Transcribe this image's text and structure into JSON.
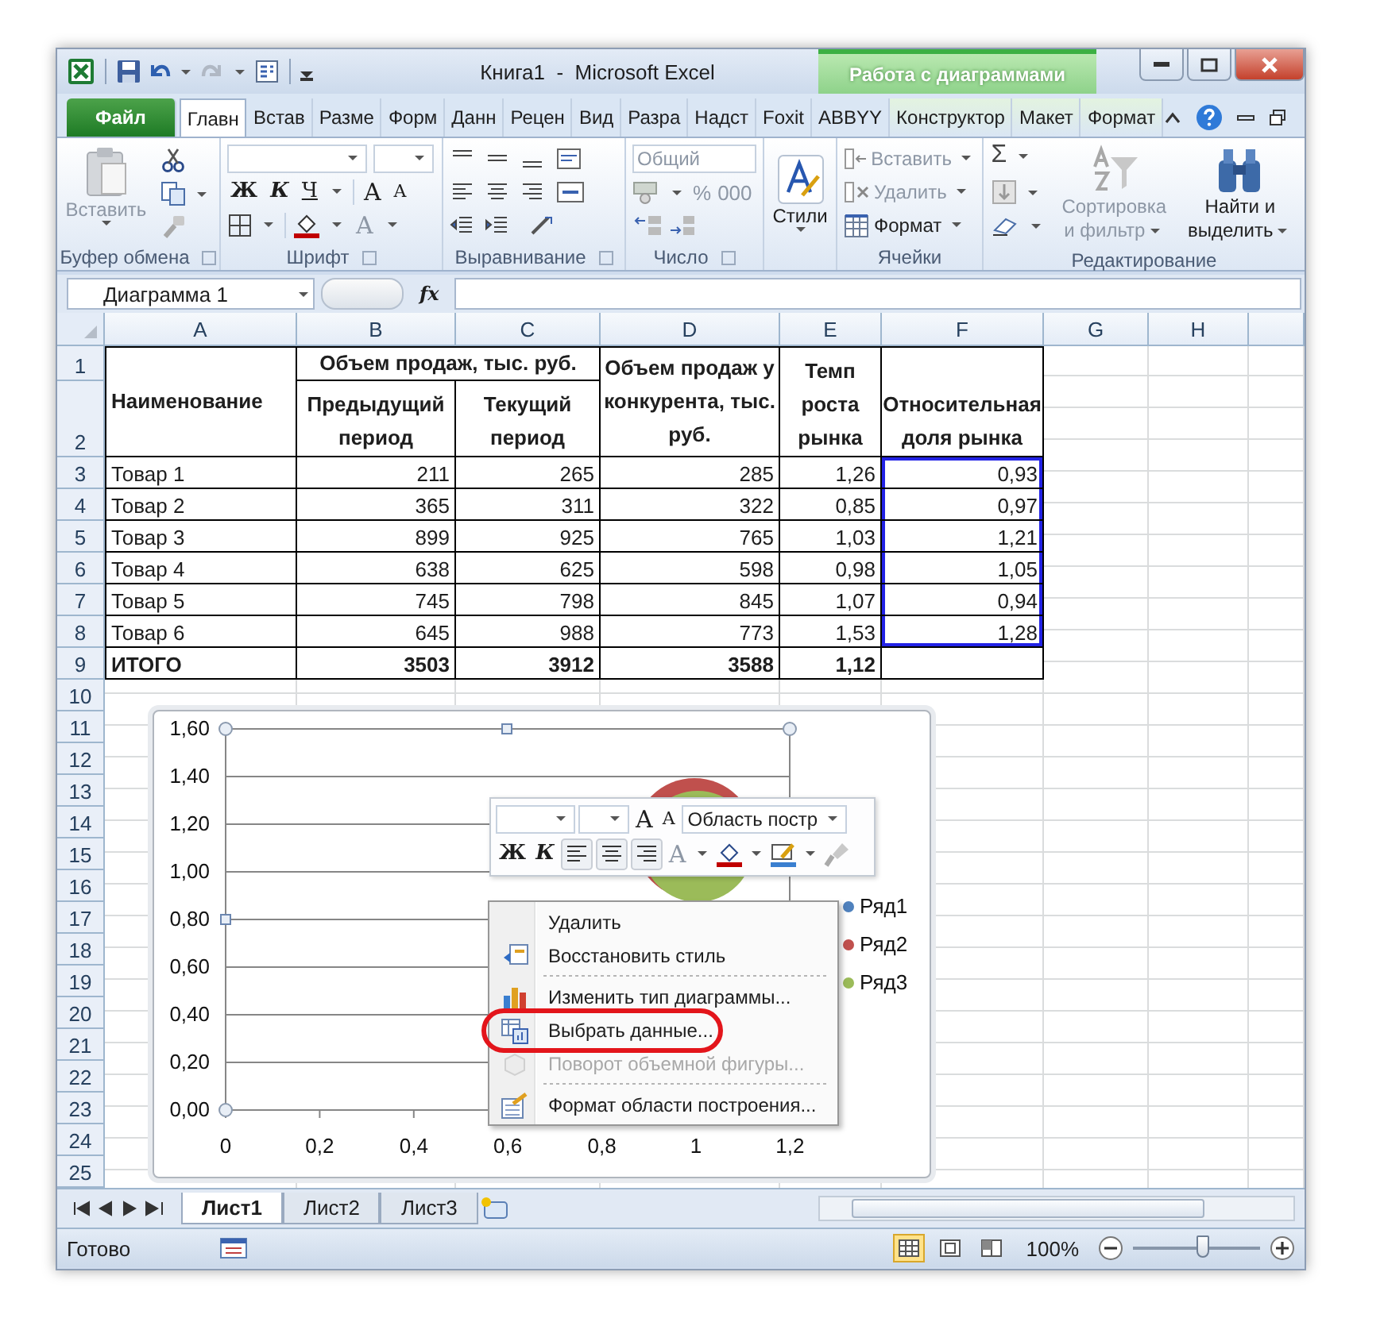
{
  "window": {
    "title": "Книга1  -  Microsoft Excel",
    "context_group": "Работа с диаграммами"
  },
  "tabs": [
    {
      "label": "Файл",
      "kind": "file",
      "selected": false
    },
    {
      "label": "Главн",
      "kind": "normal",
      "selected": true
    },
    {
      "label": "Встав",
      "kind": "normal",
      "selected": false
    },
    {
      "label": "Разме",
      "kind": "normal",
      "selected": false
    },
    {
      "label": "Форм",
      "kind": "normal",
      "selected": false
    },
    {
      "label": "Данн",
      "kind": "normal",
      "selected": false
    },
    {
      "label": "Рецен",
      "kind": "normal",
      "selected": false
    },
    {
      "label": "Вид",
      "kind": "normal",
      "selected": false
    },
    {
      "label": "Разра",
      "kind": "normal",
      "selected": false
    },
    {
      "label": "Надст",
      "kind": "normal",
      "selected": false
    },
    {
      "label": "Foxit",
      "kind": "normal",
      "selected": false
    },
    {
      "label": "ABBYY",
      "kind": "normal",
      "selected": false
    },
    {
      "label": "Конструктор",
      "kind": "context",
      "selected": false
    },
    {
      "label": "Макет",
      "kind": "context",
      "selected": false
    },
    {
      "label": "Формат",
      "kind": "context",
      "selected": false
    }
  ],
  "ribbon": {
    "clipboard": {
      "label": "Буфер обмена",
      "paste": {
        "label": "Вставить",
        "disabled": true
      }
    },
    "font": {
      "label": "Шрифт",
      "bold": "Ж",
      "italic": "К",
      "underline": "Ч",
      "grow": "A",
      "shrink": "A",
      "font_color_key": "A"
    },
    "alignment": {
      "label": "Выравнивание"
    },
    "number": {
      "label": "Число",
      "format": "Общий",
      "percent": "%",
      "thousands": "000"
    },
    "styles": {
      "label": "Стили"
    },
    "cells": {
      "label": "Ячейки",
      "items": [
        {
          "label": "Вставить",
          "kind": "insert",
          "disabled": true
        },
        {
          "label": "Удалить",
          "kind": "delete",
          "disabled": true
        },
        {
          "label": "Формат",
          "kind": "format",
          "disabled": false
        }
      ]
    },
    "editing": {
      "label": "Редактирование",
      "sum": "Σ",
      "sort": {
        "lines": [
          "Сортировка",
          "и фильтр"
        ],
        "disabled": true
      },
      "find": {
        "lines": [
          "Найти и",
          "выделить"
        ],
        "disabled": false
      }
    }
  },
  "formula_bar": {
    "name_box": "Диаграмма 1",
    "fx": "fx"
  },
  "sheet": {
    "columns": [
      "A",
      "B",
      "C",
      "D",
      "E",
      "F",
      "G",
      "H"
    ],
    "rows": [
      "1",
      "2",
      "3",
      "4",
      "5",
      "6",
      "7",
      "8",
      "9",
      "10",
      "11",
      "12",
      "13",
      "14",
      "15",
      "16",
      "17",
      "18",
      "19",
      "20",
      "21",
      "22",
      "23",
      "24",
      "25"
    ]
  },
  "table": {
    "group_header": "Объем продаж, тыс. руб.",
    "headers": [
      {
        "lines": [
          "Наименование"
        ]
      },
      {
        "lines": [
          "Предыдущий",
          "период"
        ]
      },
      {
        "lines": [
          "Текущий",
          "период"
        ]
      },
      {
        "lines": [
          "Объем продаж у",
          "конкурента, тыс.",
          "руб."
        ]
      },
      {
        "lines": [
          "Темп",
          "роста",
          "рынка"
        ]
      },
      {
        "lines": [
          "Относительная",
          "доля рынка"
        ]
      }
    ],
    "rows": [
      {
        "cells": [
          "Товар 1",
          "211",
          "265",
          "285",
          "1,26",
          "0,93"
        ],
        "selected": true
      },
      {
        "cells": [
          "Товар 2",
          "365",
          "311",
          "322",
          "0,85",
          "0,97"
        ],
        "selected": true
      },
      {
        "cells": [
          "Товар 3",
          "899",
          "925",
          "765",
          "1,03",
          "1,21"
        ],
        "selected": true
      },
      {
        "cells": [
          "Товар 4",
          "638",
          "625",
          "598",
          "0,98",
          "1,05"
        ],
        "selected": true
      },
      {
        "cells": [
          "Товар 5",
          "745",
          "798",
          "845",
          "1,07",
          "0,94"
        ],
        "selected": true
      },
      {
        "cells": [
          "Товар 6",
          "645",
          "988",
          "773",
          "1,53",
          "1,28"
        ],
        "selected": true
      }
    ],
    "total": {
      "cells": [
        "ИТОГО",
        "3503",
        "3912",
        "3588",
        "1,12"
      ]
    }
  },
  "chart": {
    "y_labels": [
      "1,60",
      "1,40",
      "1,20",
      "1,00",
      "0,80",
      "0,60",
      "0,40",
      "0,20",
      "0,00"
    ],
    "x_labels": [
      "0",
      "0,2",
      "0,4",
      "0,6",
      "0,8",
      "1",
      "1,2"
    ],
    "legend": [
      {
        "label": "Ряд1",
        "color": "#4f81bd"
      },
      {
        "label": "Ряд2",
        "color": "#c0504d"
      },
      {
        "label": "Ряд3",
        "color": "#9bbb59"
      }
    ]
  },
  "mini_toolbar": {
    "grow": "A",
    "shrink": "A",
    "element": "Область постр",
    "bold": "Ж",
    "italic": "К",
    "font_color": "A"
  },
  "context_menu": {
    "items": [
      {
        "label": "Удалить",
        "kind": "delete",
        "disabled": false,
        "separator_after": false,
        "circled": false
      },
      {
        "label": "Восстановить стиль",
        "kind": "restore",
        "disabled": false,
        "separator_after": true,
        "circled": false
      },
      {
        "label": "Изменить тип диаграммы...",
        "kind": "chart_type",
        "disabled": false,
        "separator_after": false,
        "circled": false
      },
      {
        "label": "Выбрать данные...",
        "kind": "data",
        "disabled": false,
        "separator_after": false,
        "circled": true
      },
      {
        "label": "Поворот объемной фигуры...",
        "kind": "rotate",
        "disabled": true,
        "separator_after": true,
        "circled": false
      },
      {
        "label": "Формат области построения...",
        "kind": "format",
        "disabled": false,
        "separator_after": false,
        "circled": false
      }
    ]
  },
  "sheet_tabs": [
    {
      "label": "Лист1",
      "selected": true
    },
    {
      "label": "Лист2",
      "selected": false
    },
    {
      "label": "Лист3",
      "selected": false
    }
  ],
  "status_bar": {
    "status": "Готово",
    "views": [
      {
        "kind": "normal",
        "selected": true
      },
      {
        "kind": "page_layout",
        "selected": false
      },
      {
        "kind": "page_break",
        "selected": false
      }
    ],
    "zoom": "100%",
    "zoom_slider": {
      "level": 0.55
    }
  }
}
